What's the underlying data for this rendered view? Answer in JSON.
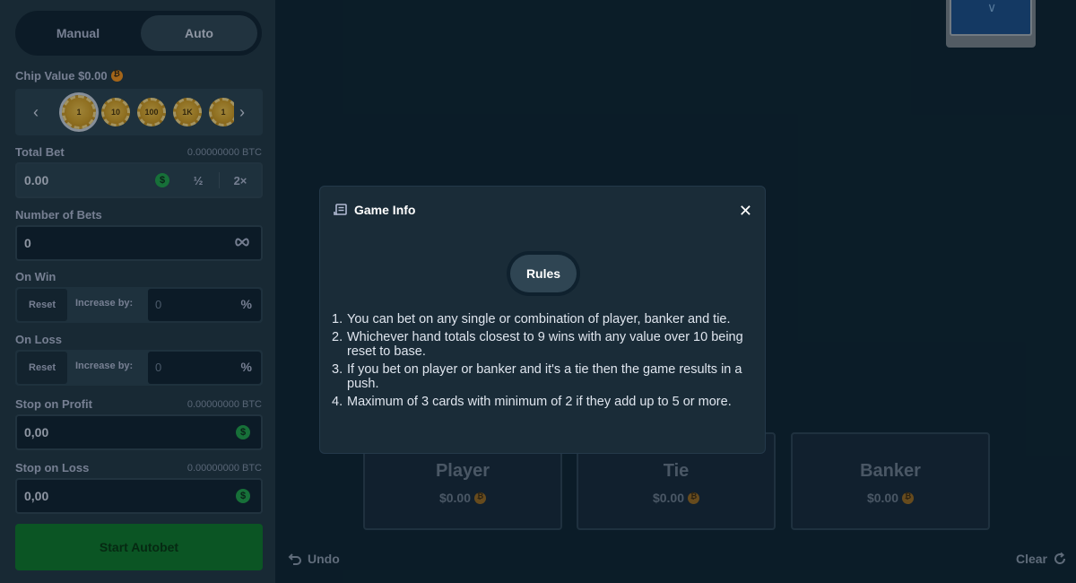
{
  "sidebar": {
    "mode_tabs": [
      "Manual",
      "Auto"
    ],
    "chip_value_label": "Chip Value $0.00",
    "chips": [
      "1",
      "10",
      "100",
      "1K",
      "1"
    ],
    "total_bet_label": "Total Bet",
    "total_bet_btc": "0.00000000 BTC",
    "total_bet_value": "0.00",
    "half_label": "½",
    "double_label": "2×",
    "number_of_bets_label": "Number of Bets",
    "number_of_bets_value": "0",
    "on_win_label": "On Win",
    "on_loss_label": "On Loss",
    "reset_label": "Reset",
    "increase_by_label": "Increase by:",
    "increase_value": "0",
    "percent_symbol": "%",
    "stop_on_profit_label": "Stop on Profit",
    "stop_on_profit_btc": "0.00000000 BTC",
    "stop_on_profit_value": "0,00",
    "stop_on_loss_label": "Stop on Loss",
    "stop_on_loss_btc": "0.00000000 BTC",
    "stop_on_loss_value": "0,00",
    "start_button": "Start Autobet"
  },
  "game": {
    "bets": [
      {
        "name": "Player",
        "amount": "$0.00"
      },
      {
        "name": "Tie",
        "amount": "$0.00"
      },
      {
        "name": "Banker",
        "amount": "$0.00"
      }
    ],
    "undo_label": "Undo",
    "clear_label": "Clear"
  },
  "modal": {
    "title": "Game Info",
    "tab": "Rules",
    "rules": [
      "You can bet on any single or combination of player, banker and tie.",
      "Whichever hand totals closest to 9 wins with any value over 10 being reset to base.",
      "If you bet on player or banker and it's a tie then the game results in a push.",
      "Maximum of 3 cards with minimum of 2 if they add up to 5 or more."
    ]
  },
  "colors": {
    "sidebar_bg": "#213743",
    "main_bg": "#0d2330",
    "modal_bg": "#1a2c38",
    "start_button": "#0d7a2a"
  }
}
